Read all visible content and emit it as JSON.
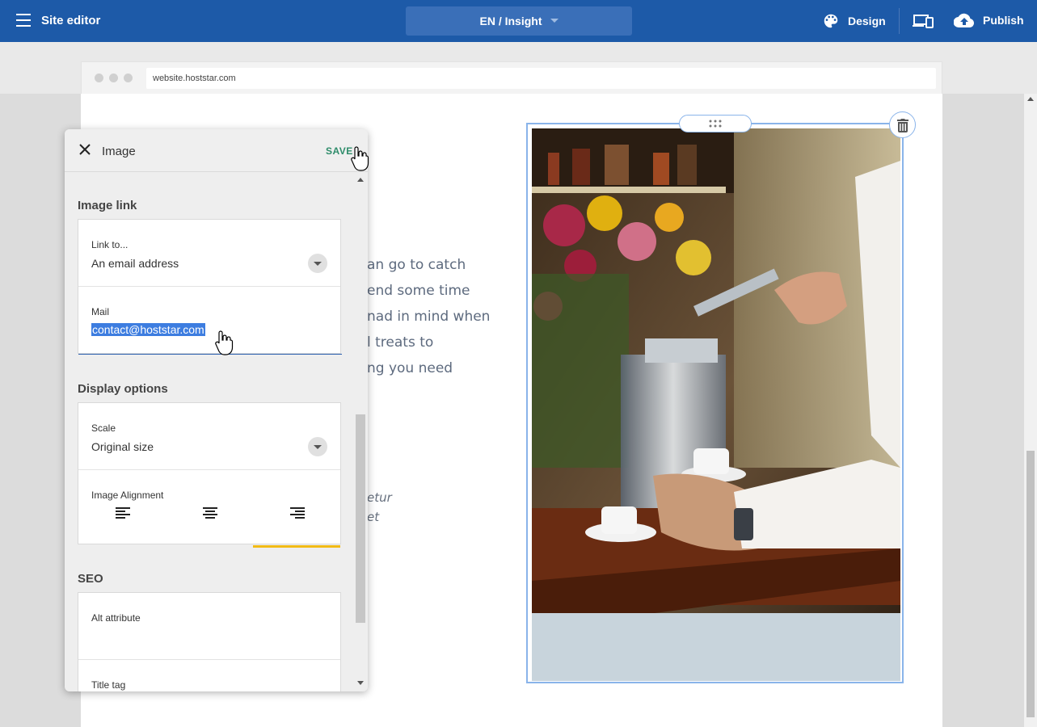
{
  "topbar": {
    "title": "Site editor",
    "language_page": "EN / Insight",
    "design_label": "Design",
    "publish_label": "Publish"
  },
  "browser": {
    "url": "website.hoststar.com"
  },
  "page": {
    "body_lines": [
      "an go to catch",
      "end some time",
      "nad in mind when",
      "l treats to",
      "ng you need"
    ],
    "italic_lines": [
      "etur",
      "et"
    ]
  },
  "panel": {
    "title": "Image",
    "save_label": "SAVE",
    "image_link": {
      "section_title": "Image link",
      "link_to_label": "Link to...",
      "link_to_value": "An email address",
      "mail_label": "Mail",
      "mail_value": "contact@hoststar.com"
    },
    "display_options": {
      "section_title": "Display options",
      "scale_label": "Scale",
      "scale_value": "Original size",
      "alignment_label": "Image Alignment",
      "alignment_options": [
        "left",
        "center",
        "right"
      ],
      "alignment_selected": "right"
    },
    "seo": {
      "section_title": "SEO",
      "alt_label": "Alt attribute",
      "alt_value": "",
      "title_label": "Title tag"
    }
  },
  "colors": {
    "topbar": "#1d5aa8",
    "accent_save": "#2e8c6a",
    "selection": "#3d7de0",
    "active_tab": "#f2bb16",
    "image_frame": "#8ab4ea"
  }
}
